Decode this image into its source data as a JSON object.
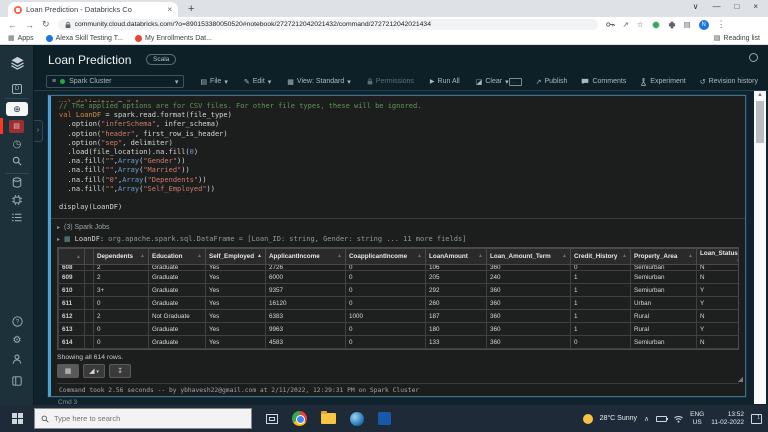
{
  "browser": {
    "tab_title": "Loan Prediction - Databricks Co",
    "url": "community.cloud.databricks.com/?o=890153380050520#notebook/2727212042021432/command/2727212042021434",
    "profile_initial": "N",
    "bookmarks": {
      "apps": "Apps",
      "alexa": "Alexa Skill Testing T...",
      "enrollments": "My Enrollments Dat...",
      "reading_list": "Reading list"
    }
  },
  "header": {
    "title": "Loan Prediction",
    "language_badge": "Scala"
  },
  "toolbar": {
    "cluster_label": "Spark Cluster",
    "file": "File",
    "edit": "Edit",
    "view": "View: Standard",
    "permissions": "Permissions",
    "run_all": "Run All",
    "clear": "Clear",
    "publish": "Publish",
    "comments": "Comments",
    "experiment": "Experiment",
    "revision_history": "Revision history"
  },
  "code": {
    "lines": [
      [
        [
          "kw",
          "val "
        ],
        [
          "vr",
          "delimiter"
        ],
        [
          "pl",
          " = "
        ],
        [
          "st",
          "\",\""
        ]
      ],
      [
        [
          "cm",
          "// The applied options are for CSV files. For other file types, these will be ignored."
        ]
      ],
      [
        [
          "kw",
          "val "
        ],
        [
          "vr",
          "LoanDF"
        ],
        [
          "pl",
          " = spark.read.format(file_type)"
        ]
      ],
      [
        [
          "pl",
          "  .option("
        ],
        [
          "st",
          "\"inferSchema\""
        ],
        [
          "pl",
          ", infer_schema)"
        ]
      ],
      [
        [
          "pl",
          "  .option("
        ],
        [
          "st",
          "\"header\""
        ],
        [
          "pl",
          ", first_row_is_header)"
        ]
      ],
      [
        [
          "pl",
          "  .option("
        ],
        [
          "st",
          "\"sep\""
        ],
        [
          "pl",
          ", delimiter)"
        ]
      ],
      [
        [
          "pl",
          "  .load(file_location).na.fill("
        ],
        [
          "nm",
          "0"
        ],
        [
          "pl",
          ")"
        ]
      ],
      [
        [
          "pl",
          "  .na.fill("
        ],
        [
          "st",
          "\"\""
        ],
        [
          "pl",
          ","
        ],
        [
          "fn",
          "Array"
        ],
        [
          "pl",
          "("
        ],
        [
          "st",
          "\"Gender\""
        ],
        [
          "pl",
          "))"
        ]
      ],
      [
        [
          "pl",
          "  .na.fill("
        ],
        [
          "st",
          "\"\""
        ],
        [
          "pl",
          ","
        ],
        [
          "fn",
          "Array"
        ],
        [
          "pl",
          "("
        ],
        [
          "st",
          "\"Married\""
        ],
        [
          "pl",
          "))"
        ]
      ],
      [
        [
          "pl",
          "  .na.fill("
        ],
        [
          "st",
          "\"0\""
        ],
        [
          "pl",
          ","
        ],
        [
          "fn",
          "Array"
        ],
        [
          "pl",
          "("
        ],
        [
          "st",
          "\"Dependents\""
        ],
        [
          "pl",
          "))"
        ]
      ],
      [
        [
          "pl",
          "  .na.fill("
        ],
        [
          "st",
          "\"\""
        ],
        [
          "pl",
          ","
        ],
        [
          "fn",
          "Array"
        ],
        [
          "pl",
          "("
        ],
        [
          "st",
          "\"Self_Employed\""
        ],
        [
          "pl",
          "))"
        ]
      ],
      [
        [
          "pl",
          ""
        ]
      ],
      [
        [
          "pl",
          "display(LoanDF)"
        ]
      ]
    ]
  },
  "results": {
    "spark_jobs": "(3) Spark Jobs",
    "dataframe_name": "LoanDF:",
    "dataframe_type": "org.apache.spark.sql.DataFrame = [Loan_ID: string, Gender: string ... 11 more fields]",
    "table": {
      "columns": [
        "",
        "",
        "Dependents",
        "Education",
        "Self_Employed",
        "ApplicantIncome",
        "CoapplicantIncome",
        "LoanAmount",
        "Loan_Amount_Term",
        "Credit_History",
        "Property_Area",
        "Loan_Status"
      ],
      "sorted_column": "Self_Employed",
      "rows": [
        {
          "n": "608",
          "c": [
            "2",
            "Graduate",
            "Yes",
            "2726",
            "0",
            "106",
            "360",
            "0",
            "Semiurban",
            "N"
          ]
        },
        {
          "n": "609",
          "c": [
            "2",
            "Graduate",
            "Yes",
            "6000",
            "0",
            "205",
            "240",
            "1",
            "Semiurban",
            "N"
          ]
        },
        {
          "n": "610",
          "c": [
            "3+",
            "Graduate",
            "Yes",
            "9357",
            "0",
            "292",
            "360",
            "1",
            "Semiurban",
            "Y"
          ]
        },
        {
          "n": "611",
          "c": [
            "0",
            "Graduate",
            "Yes",
            "16120",
            "0",
            "260",
            "360",
            "1",
            "Urban",
            "Y"
          ]
        },
        {
          "n": "612",
          "c": [
            "2",
            "Not Graduate",
            "Yes",
            "6383",
            "1000",
            "187",
            "360",
            "1",
            "Rural",
            "N"
          ]
        },
        {
          "n": "613",
          "c": [
            "0",
            "Graduate",
            "Yes",
            "9963",
            "0",
            "180",
            "360",
            "1",
            "Rural",
            "Y"
          ]
        },
        {
          "n": "614",
          "c": [
            "0",
            "Graduate",
            "Yes",
            "4583",
            "0",
            "133",
            "360",
            "0",
            "Semiurban",
            "N"
          ]
        }
      ]
    },
    "showing": "Showing all 614 rows.",
    "command_status": "Command took 2.56 seconds -- by ybhavesh22@gmail.com at 2/11/2022, 12:29:31 PM on Spark Cluster"
  },
  "cell_label": "Cmd 3",
  "taskbar": {
    "search_placeholder": "Type here to search",
    "weather": "28°C Sunny",
    "lang_top": "ENG",
    "lang_bottom": "US",
    "time": "13:52",
    "date": "11-02-2022",
    "notification_badge": "1"
  },
  "icons": {
    "close": "×",
    "minimize": "—",
    "maximize": "□",
    "chevron_down": "∨",
    "plus": "+",
    "back": "←",
    "forward": "→",
    "refresh": "↻",
    "star": "☆",
    "menu_dots": "⋮",
    "apps_grid": "▦",
    "reading_list": "▤",
    "caret_down": "▾",
    "file": "▤",
    "edit": "✎",
    "view": "▦",
    "play": "▶",
    "eraser": "◪",
    "publish": "↗",
    "history": "↺",
    "clock": "◷",
    "gear": "⚙",
    "help": "?",
    "plus_circle": "⊕",
    "expander": "▸",
    "table_small": "▦",
    "sort_arrow": "▲",
    "grid": "▦",
    "chart": "◢",
    "download": "↧",
    "cluster": "≡",
    "chevron_right": "›",
    "caret_up": "∧",
    "scroll_up": "▲",
    "notebook": "▤",
    "workspace_letter": "D"
  }
}
